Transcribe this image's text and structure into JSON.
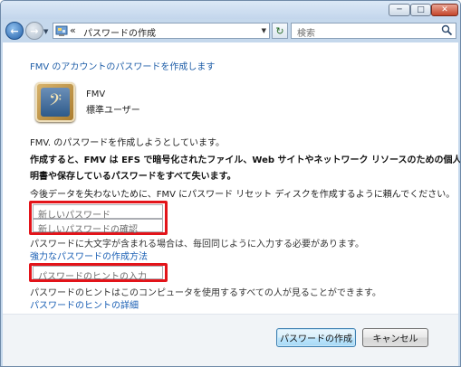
{
  "window": {
    "controls": {
      "minimize": "─",
      "maximize": "□",
      "close": "✕"
    }
  },
  "navbar": {
    "back_icon": "←",
    "forward_icon": "→",
    "address_chevron": "«",
    "breadcrumb": "パスワードの作成",
    "search_placeholder": "検索",
    "refresh_icon": "↻"
  },
  "content": {
    "header": "FMV のアカウントのパスワードを作成します",
    "user_name": "FMV",
    "user_type": "標準ユーザー",
    "intro": "FMV. のパスワードを作成しようとしています。",
    "warning_line1": "作成すると、FMV は EFS で暗号化されたファイル、Web サイトやネットワーク リソースのための個人証",
    "warning_line2": "明書や保存しているパスワードをすべて失います。",
    "advice": "今後データを失わないために、FMV にパスワード リセット ディスクを作成するように頼んでください。",
    "new_password_placeholder": "新しいパスワード",
    "confirm_password_placeholder": "新しいパスワードの確認",
    "case_note": "パスワードに大文字が含まれる場合は、毎回同じように入力する必要があります。",
    "strong_password_link": "強力なパスワードの作成方法",
    "hint_placeholder": "パスワードのヒントの入力",
    "hint_note": "パスワードのヒントはこのコンピュータを使用するすべての人が見ることができます。",
    "hint_detail_link": "パスワードのヒントの詳細"
  },
  "buttons": {
    "create_password": "パスワードの作成",
    "cancel": "キャンセル"
  },
  "colors": {
    "link": "#1a5fb4",
    "highlight": "#e3141a",
    "window_frame": "#c5d8ec"
  },
  "icons": {
    "avatar": "user-avatar-icon",
    "control_panel": "control-panel-icon",
    "search": "search-icon"
  }
}
